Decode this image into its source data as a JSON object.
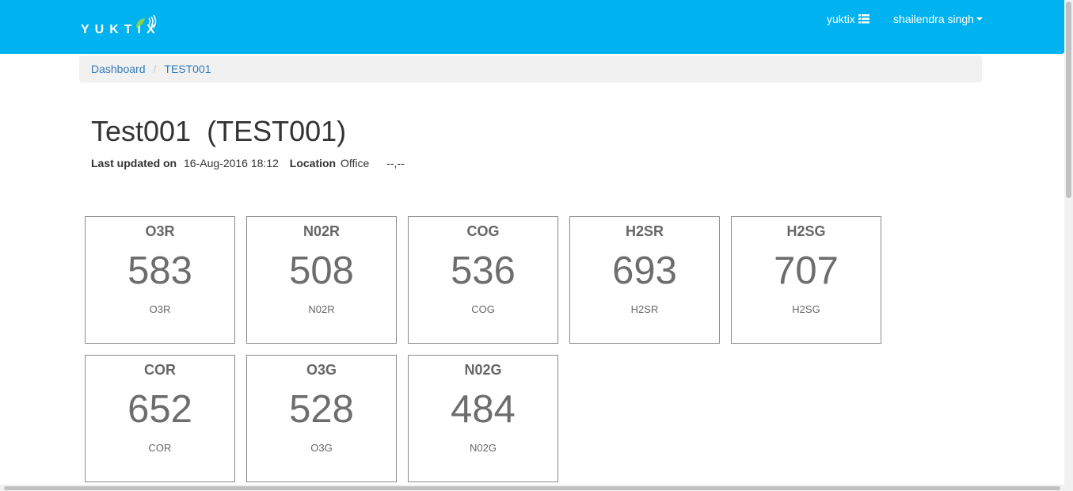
{
  "navbar": {
    "logo_text": "YUKTIX",
    "brand_menu_label": "yuktix",
    "user_menu_label": "shailendra singh"
  },
  "breadcrumb": {
    "items": [
      {
        "label": "Dashboard"
      },
      {
        "label": "TEST001"
      }
    ]
  },
  "device": {
    "title": "Test001  (TEST001)",
    "last_updated_label": "Last updated on",
    "last_updated_value": "16-Aug-2016 18:12",
    "location_label": "Location",
    "location_value": "Office",
    "coordinates": "--,--"
  },
  "tiles": [
    {
      "name": "O3R",
      "value": "583",
      "unit": "O3R"
    },
    {
      "name": "N02R",
      "value": "508",
      "unit": "N02R"
    },
    {
      "name": "COG",
      "value": "536",
      "unit": "COG"
    },
    {
      "name": "H2SR",
      "value": "693",
      "unit": "H2SR"
    },
    {
      "name": "H2SG",
      "value": "707",
      "unit": "H2SG"
    },
    {
      "name": "COR",
      "value": "652",
      "unit": "COR"
    },
    {
      "name": "O3G",
      "value": "528",
      "unit": "O3G"
    },
    {
      "name": "N02G",
      "value": "484",
      "unit": "N02G"
    }
  ],
  "colors": {
    "navbar": "#00b2ef",
    "link": "#337ab7",
    "tile_border": "#8a8a8a",
    "tile_text": "#6d6d6d"
  },
  "icons": {
    "brand_menu": "list-icon",
    "user_menu": "caret-down-icon",
    "logo_mark": "leaf-signal-icon"
  }
}
